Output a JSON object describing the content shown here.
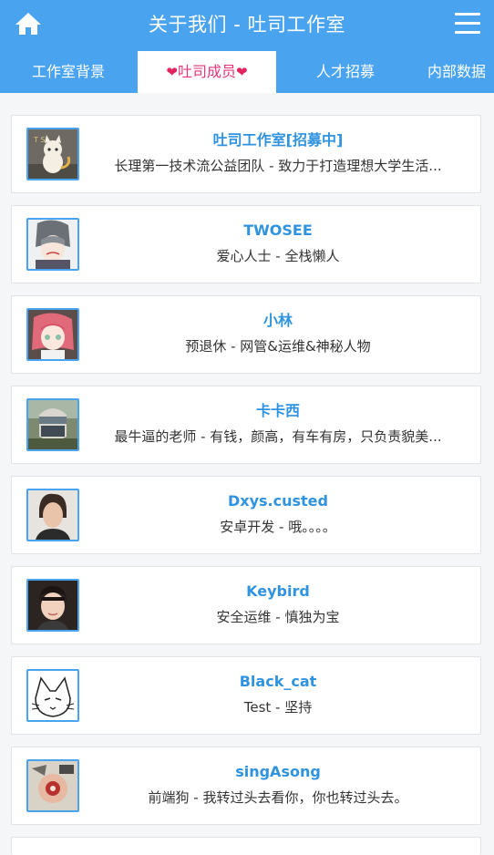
{
  "header": {
    "title": "关于我们 - 吐司工作室",
    "home_icon": "home-icon",
    "menu_icon": "hamburger-menu-icon"
  },
  "tabs": [
    {
      "label": "工作室背景",
      "active": false
    },
    {
      "label": "吐司成员",
      "active": true
    },
    {
      "label": "人才招募",
      "active": false
    },
    {
      "label": "内部数据",
      "active": false
    }
  ],
  "members": [
    {
      "name": "吐司工作室[招募中]",
      "desc": "长理第一技术流公益团队 - 致力于打造理想大学生活..."
    },
    {
      "name": "TWOSEE",
      "desc": "爱心人士 - 全栈懒人"
    },
    {
      "name": "小林",
      "desc": "预退休 - 网管&运维&神秘人物"
    },
    {
      "name": "卡卡西",
      "desc": "最牛逼的老师 - 有钱，颜高，有车有房，只负责貌美..."
    },
    {
      "name": "Dxys.custed",
      "desc": "安卓开发 - 哦。。。。"
    },
    {
      "name": "Keybird",
      "desc": "安全运维 - 慎独为宝"
    },
    {
      "name": "Black_cat",
      "desc": "Test - 坚持"
    },
    {
      "name": "singAsong",
      "desc": "前端狗 - 我转过头去看你，你也转过头去。"
    }
  ],
  "colors": {
    "header": "#4aa3ee",
    "active_tab_text": "#e6357a",
    "member_name": "#2f93e0"
  }
}
